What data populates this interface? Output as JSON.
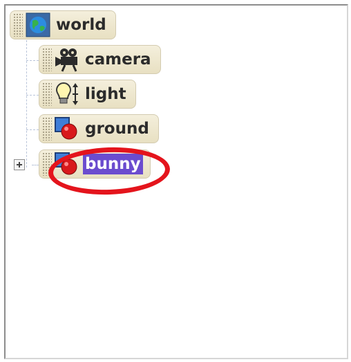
{
  "tree": {
    "root": {
      "label": "world",
      "icon": "world-globe-icon"
    },
    "children": [
      {
        "label": "camera",
        "icon": "camera-icon",
        "selected": false,
        "expandable": false
      },
      {
        "label": "light",
        "icon": "lightbulb-icon",
        "selected": false,
        "expandable": false
      },
      {
        "label": "ground",
        "icon": "object-shape-icon",
        "selected": false,
        "expandable": false
      },
      {
        "label": "bunny",
        "icon": "object-shape-icon",
        "selected": true,
        "expandable": true
      }
    ]
  },
  "colors": {
    "selection": "#6b4ccf",
    "annotation": "#e4141c",
    "node_background": "#ede6cd"
  }
}
